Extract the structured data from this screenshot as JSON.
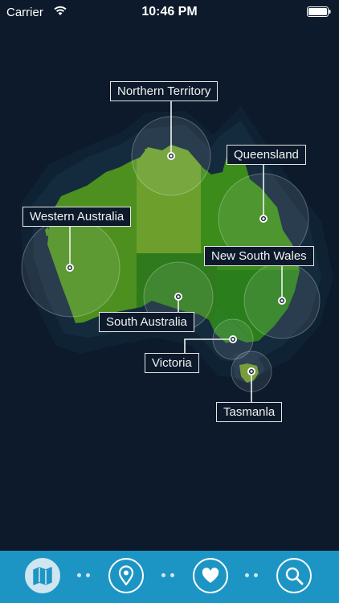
{
  "status_bar": {
    "carrier": "Carrier",
    "time": "10:46 PM",
    "wifi_icon": "wifi-icon",
    "battery_icon": "battery-icon"
  },
  "map": {
    "regions": [
      {
        "id": "western-australia",
        "label": "Western Australia"
      },
      {
        "id": "northern-territory",
        "label": "Northern Territory"
      },
      {
        "id": "queensland",
        "label": "Queensland"
      },
      {
        "id": "new-south-wales",
        "label": "New South Wales"
      },
      {
        "id": "south-australia",
        "label": "South Australia"
      },
      {
        "id": "victoria",
        "label": "Victoria"
      },
      {
        "id": "tasmania",
        "label": "Tasmanla"
      }
    ],
    "colors": {
      "background": "#0c1a2b",
      "western_australia": "#4e9020",
      "northern_territory": "#6c9f2c",
      "queensland": "#3c8c1c",
      "south_australia": "#2f7a1c",
      "new_south_wales": "#2a7f1c",
      "victoria": "#2b7f23",
      "tasmania": "#6c9428"
    }
  },
  "tab_bar": {
    "color": "#1d95c4",
    "items": [
      {
        "name": "map-tab",
        "icon": "map-icon",
        "active": true
      },
      {
        "name": "location-tab",
        "icon": "location-pin-icon",
        "active": false
      },
      {
        "name": "favorites-tab",
        "icon": "heart-icon",
        "active": false
      },
      {
        "name": "search-tab",
        "icon": "search-icon",
        "active": false
      }
    ]
  }
}
